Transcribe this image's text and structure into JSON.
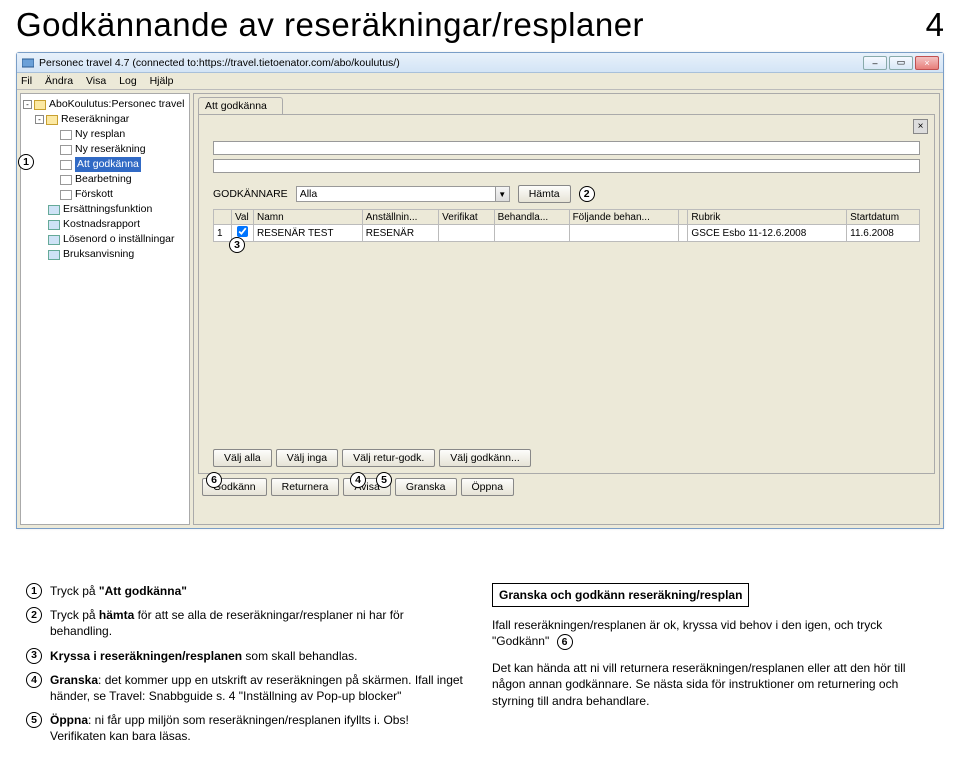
{
  "page": {
    "title": "Godkännande av reseräkningar/resplaner",
    "number": "4"
  },
  "window": {
    "title": "Personec travel 4.7   (connected to:https://travel.tietoenator.com/abo/koulutus/)",
    "menubar": [
      "Fil",
      "Ändra",
      "Visa",
      "Log",
      "Hjälp"
    ],
    "winbtns": {
      "min": "–",
      "max": "▭",
      "close": "×"
    }
  },
  "tree": {
    "root_sq": "-",
    "root": "AboKoulutus:Personec travel",
    "items": [
      {
        "sq": "-",
        "lvl": 1,
        "ic": "fold",
        "label": "Reseräkningar"
      },
      {
        "lvl": 2,
        "ic": "doc",
        "label": "Ny resplan"
      },
      {
        "lvl": 2,
        "ic": "doc",
        "label": "Ny reseräkning"
      },
      {
        "lvl": 2,
        "ic": "doc",
        "label": "Att godkänna",
        "sel": true
      },
      {
        "lvl": 2,
        "ic": "doc",
        "label": "Bearbetning"
      },
      {
        "lvl": 2,
        "ic": "doc",
        "label": "Förskott"
      },
      {
        "lvl": 1,
        "ic": "blue",
        "label": "Ersättningsfunktion"
      },
      {
        "lvl": 1,
        "ic": "blue",
        "label": "Kostnadsrapport"
      },
      {
        "lvl": 1,
        "ic": "blue",
        "label": "Lösenord o inställningar"
      },
      {
        "lvl": 1,
        "ic": "blue",
        "label": "Bruksanvisning"
      }
    ]
  },
  "maintab": {
    "label": "Att godkänna"
  },
  "filter": {
    "label": "GODKÄNNARE",
    "combo_value": "Alla",
    "fetch_btn": "Hämta"
  },
  "table": {
    "headers": [
      "",
      "Val",
      "Namn",
      "Anställnin...",
      "Verifikat",
      "Behandla...",
      "Följande behan...",
      "",
      "Rubrik",
      "Startdatum"
    ],
    "rows": [
      {
        "n": "1",
        "checked": true,
        "cells": [
          "RESENÄR TEST",
          "RESENÄR",
          "",
          "",
          "",
          "",
          "GSCE Esbo 11-12.6.2008",
          "11.6.2008"
        ]
      }
    ]
  },
  "lowerbtns": [
    "Välj alla",
    "Välj inga",
    "Välj retur-godk.",
    "Välj godkänn..."
  ],
  "footerbtns": [
    "Godkänn",
    "Returnera",
    "Avisa",
    "Granska",
    "Öppna"
  ],
  "explain_left": [
    {
      "n": "1",
      "html": "Tryck på <b>\"Att godkänna\"</b>"
    },
    {
      "n": "2",
      "html": "Tryck på <b>hämta</b> för att se alla de reseräkningar/resplaner ni har för behandling."
    },
    {
      "n": "3",
      "html": "<b>Kryssa i reseräkningen/resplanen</b> som skall behandlas."
    },
    {
      "n": "4",
      "html": "<b>Granska</b>: det kommer upp en utskrift av reseräkningen på skärmen. Ifall inget händer, se Travel: Snabbguide s. 4 \"Inställning av Pop-up blocker\""
    },
    {
      "n": "5",
      "html": "<b>Öppna</b>: ni får upp miljön som reseräkningen/resplanen ifyllts i. Obs! Verifikaten kan bara läsas."
    }
  ],
  "explain_right": {
    "box_title": "Granska och godkänn reseräkning/resplan",
    "p1_before": "Ifall reseräkningen/resplanen är ok, kryssa vid behov i den igen, och tryck \"Godkänn\"",
    "p1_circle": "6",
    "p2": "Det kan hända att ni vill returnera reseräkningen/resplanen eller att den hör till någon annan godkännare. Se nästa sida för instruktioner om returnering och styrning till andra behandlare."
  },
  "annos": {
    "a1": "1",
    "a2": "2",
    "a3": "3",
    "a4": "4",
    "a5": "5",
    "a6": "6"
  }
}
